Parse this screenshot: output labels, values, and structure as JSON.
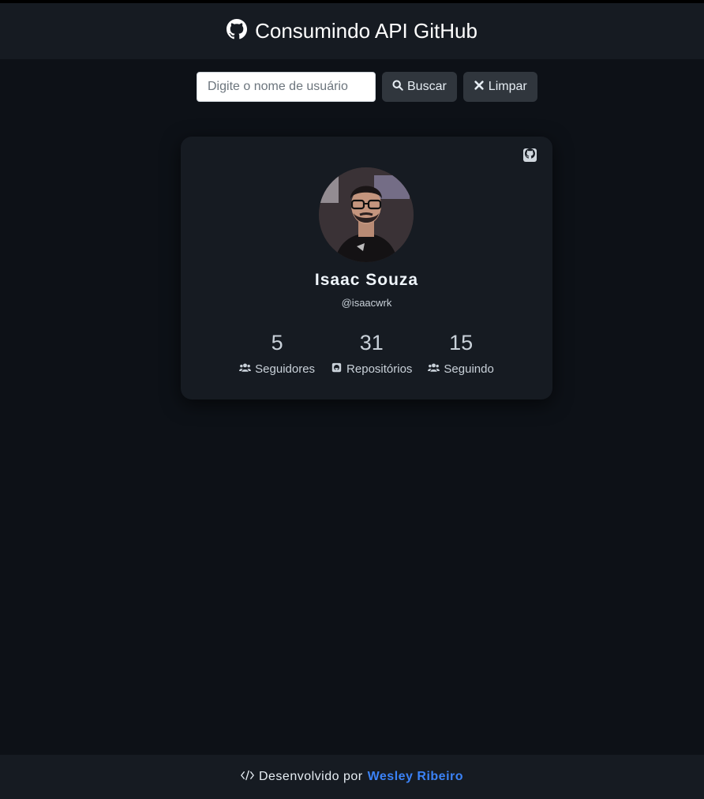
{
  "header": {
    "title": "Consumindo API GitHub",
    "icon": "github-icon"
  },
  "search": {
    "placeholder": "Digite o nome de usuário",
    "value": "",
    "search_label": "Buscar",
    "clear_label": "Limpar"
  },
  "profile": {
    "name": "Isaac Souza",
    "handle": "@isaacwrk",
    "stats": [
      {
        "value": "5",
        "label": "Seguidores",
        "icon": "users-icon"
      },
      {
        "value": "31",
        "label": "Repositórios",
        "icon": "github-square-icon"
      },
      {
        "value": "15",
        "label": "Seguindo",
        "icon": "users-icon"
      }
    ]
  },
  "footer": {
    "text": "Desenvolvido por",
    "author": "Wesley Ribeiro",
    "icon": "code-icon"
  },
  "colors": {
    "background": "#0d1117",
    "surface": "#161b22",
    "button": "#30363d",
    "accent": "#3b82f6"
  }
}
